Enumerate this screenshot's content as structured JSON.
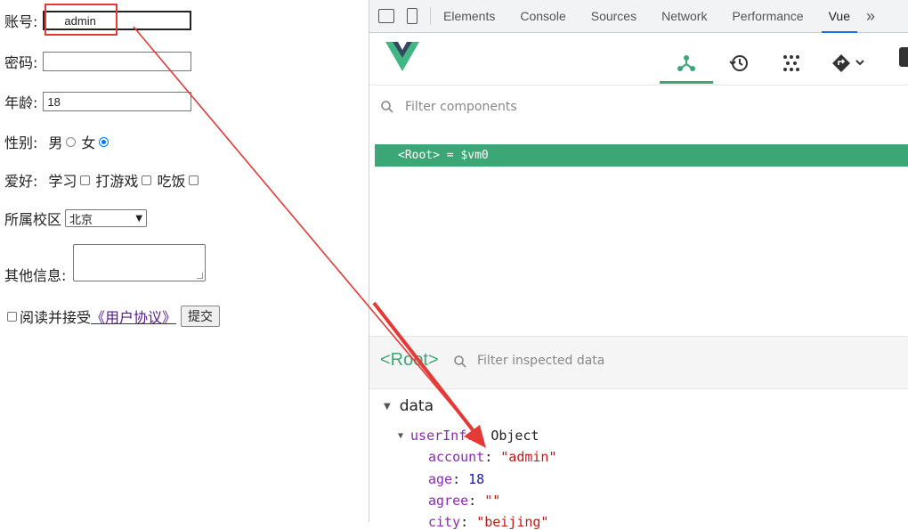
{
  "form": {
    "account_label": "账号:",
    "account_value": "admin",
    "password_label": "密码:",
    "age_label": "年龄:",
    "age_value": "18",
    "gender_label": "性别:",
    "gender_male": "男",
    "gender_female": "女",
    "hobby_label": "爱好:",
    "hobby_study": "学习",
    "hobby_game": "打游戏",
    "hobby_eat": "吃饭",
    "campus_label": "所属校区",
    "campus_value": "北京",
    "other_label": "其他信息:",
    "agree_text": "阅读并接受",
    "agree_link": "《用户协议》",
    "submit": "提交"
  },
  "devtools": {
    "tabs": [
      "Elements",
      "Console",
      "Sources",
      "Network",
      "Performance",
      "Vue"
    ],
    "more": "»"
  },
  "vue": {
    "filter_components": "Filter components",
    "root_row": "<Root> = $vm0",
    "inspected_title": "<Root>",
    "filter_inspected": "Filter inspected data",
    "data_section": "data",
    "object_key": "userInfo",
    "object_type": "Object",
    "props": [
      {
        "key": "account",
        "value": "\"admin\"",
        "kind": "str"
      },
      {
        "key": "age",
        "value": "18",
        "kind": "num"
      },
      {
        "key": "agree",
        "value": "\"\"",
        "kind": "str"
      },
      {
        "key": "city",
        "value": "\"beijing\"",
        "kind": "str"
      }
    ]
  },
  "colors": {
    "vue_green": "#3ba776",
    "annotation_red": "#e53935"
  }
}
